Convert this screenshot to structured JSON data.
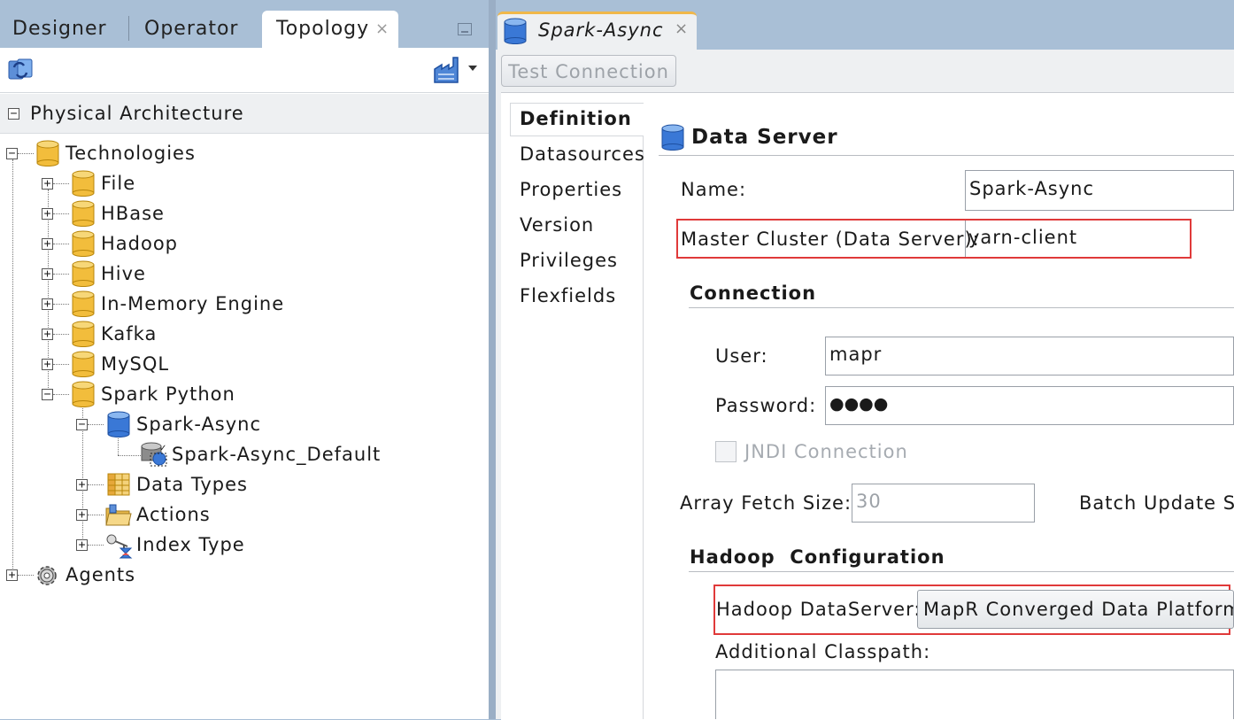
{
  "left_panel": {
    "tabs": [
      {
        "label": "Designer"
      },
      {
        "label": "Operator"
      },
      {
        "label": "Topology",
        "active": true,
        "close": "×"
      }
    ],
    "section_title": "Physical Architecture",
    "tree": {
      "technologies": "Technologies",
      "file": "File",
      "hbase": "HBase",
      "hadoop": "Hadoop",
      "hive": "Hive",
      "in_memory": "In-Memory Engine",
      "kafka": "Kafka",
      "mysql": "MySQL",
      "spark_python": "Spark Python",
      "spark_async": "Spark-Async",
      "spark_async_default": "Spark-Async_Default",
      "data_types": "Data Types",
      "actions": "Actions",
      "index_type": "Index Type",
      "agents": "Agents"
    }
  },
  "editor": {
    "tab_title": "Spark-Async",
    "tab_close": "×",
    "test_connection_label": "Test Connection",
    "nav": [
      "Definition",
      "Datasources",
      "Properties",
      "Version",
      "Privileges",
      "Flexfields"
    ],
    "active_nav": "Definition",
    "header": "Data Server",
    "name_label": "Name:",
    "name_value": "Spark-Async",
    "master_cluster_label": "Master Cluster (Data Server):",
    "master_cluster_value": "yarn-client",
    "connection_section": "Connection",
    "user_label": "User:",
    "user_value": "mapr",
    "password_label": "Password:",
    "password_value": "●●●●",
    "jndi_label": "JNDI Connection",
    "array_fetch_label": "Array Fetch Size:",
    "array_fetch_value": "30",
    "batch_update_label": "Batch Update Siz",
    "hadoop_section": "Hadoop  Configuration",
    "hadoop_dataserver_label": "Hadoop DataServer:",
    "hadoop_dataserver_value": "MapR Converged Data Platform",
    "additional_classpath_label": "Additional Classpath:"
  },
  "colors": {
    "chrome_blue": "#a9bfd6",
    "panel_grey": "#eef0f2",
    "highlight_red": "#e03a3a",
    "folder_yellow": "#f2bd3c",
    "db_blue": "#3a78d6",
    "active_tab_accent": "#f0b74a"
  },
  "icons": [
    "refresh-icon",
    "factory-icon",
    "dropdown-arrow-icon",
    "folder-cylinder-icon",
    "blue-cylinder-icon",
    "schema-icon",
    "table-icon",
    "actions-folder-icon",
    "index-type-icon",
    "gear-icon"
  ]
}
